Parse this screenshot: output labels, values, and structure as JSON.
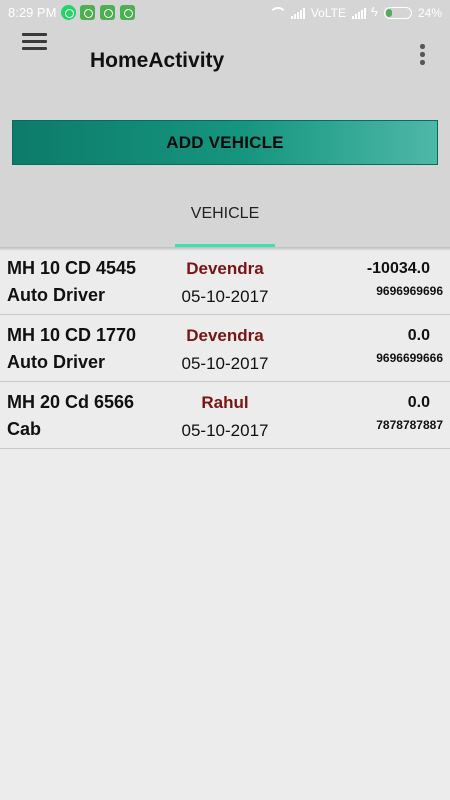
{
  "status_bar": {
    "time": "8:29 PM",
    "network": "VoLTE",
    "battery": "24%",
    "battery_level": 0.24,
    "notification_icons": [
      "whatsapp-icon",
      "android-icon",
      "android-icon",
      "android-icon"
    ]
  },
  "toolbar": {
    "title": "HomeActivity"
  },
  "add_button": {
    "label": "ADD VEHICLE"
  },
  "tabs": [
    {
      "label": "VEHICLE",
      "selected": true
    }
  ],
  "vehicles": [
    {
      "reg": "MH 10 CD 4545",
      "type": "Auto Driver",
      "driver": "Devendra",
      "date": "05-10-2017",
      "amount": "-10034.0",
      "phone": "9696969696"
    },
    {
      "reg": "MH 10 CD 1770",
      "type": "Auto Driver",
      "driver": "Devendra",
      "date": "05-10-2017",
      "amount": "0.0",
      "phone": "9696699666"
    },
    {
      "reg": "MH 20 Cd 6566",
      "type": "Cab",
      "driver": "Rahul",
      "date": "05-10-2017",
      "amount": "0.0",
      "phone": "7878787887"
    }
  ],
  "colors": {
    "toolbar_bg": "#d6d5d6",
    "accent": "#3ee0b2",
    "button_primary": "#0d7b6a",
    "driver_name": "#7a1414",
    "list_bg": "#ececec"
  }
}
